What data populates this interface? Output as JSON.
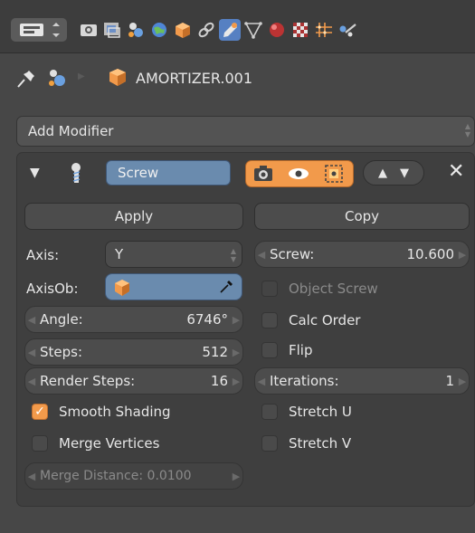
{
  "header": {
    "context_tabs": [
      "render-icon",
      "render-layers-icon",
      "scene-icon",
      "world-icon",
      "object-icon",
      "constraints-icon",
      "modifiers-icon",
      "data-icon",
      "material-icon",
      "texture-icon",
      "particles-icon",
      "physics-icon"
    ],
    "active_tab": "modifiers-icon"
  },
  "breadcrumb": {
    "object_name": "AMORTIZER.001"
  },
  "add_modifier": {
    "label": "Add Modifier"
  },
  "modifier": {
    "name": "Screw",
    "apply_label": "Apply",
    "copy_label": "Copy",
    "axis_label": "Axis:",
    "axis_value": "Y",
    "axisob_label": "AxisOb:",
    "angle_label": "Angle:",
    "angle_value": "6746°",
    "steps_label": "Steps:",
    "steps_value": "512",
    "render_steps_label": "Render Steps:",
    "render_steps_value": "16",
    "smooth_shading_label": "Smooth Shading",
    "smooth_shading_checked": true,
    "merge_vertices_label": "Merge Vertices",
    "merge_distance_label": "Merge Distance: 0.0100",
    "screw_label": "Screw:",
    "screw_value": "10.600",
    "object_screw_label": "Object Screw",
    "calc_order_label": "Calc Order",
    "flip_label": "Flip",
    "iterations_label": "Iterations:",
    "iterations_value": "1",
    "stretch_u_label": "Stretch U",
    "stretch_v_label": "Stretch V"
  },
  "colors": {
    "accent_blue": "#5680c2",
    "accent_orange": "#f29a4b",
    "panel_bg": "#3f3f3f",
    "window_bg": "#474747"
  }
}
